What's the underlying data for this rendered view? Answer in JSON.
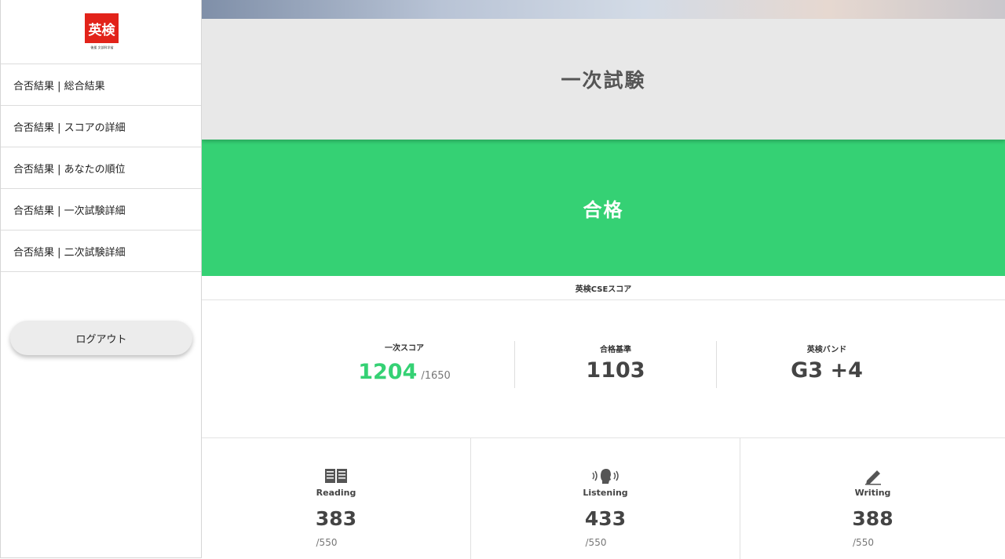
{
  "logo": {
    "text": "英検",
    "subtext": "後援 文部科学省",
    "color": "#e2231a"
  },
  "sidebar": {
    "items": [
      {
        "label": "合否結果 | 総合結果"
      },
      {
        "label": "合否結果 | スコアの詳細"
      },
      {
        "label": "合否結果 | あなたの順位"
      },
      {
        "label": "合否結果 | 一次試験詳細"
      },
      {
        "label": "合否結果 | 二次試験詳細"
      }
    ],
    "logout_label": "ログアウト"
  },
  "main": {
    "exam_title": "一次試験",
    "result": "合格",
    "result_color": "#35d174",
    "cse_label": "英検CSEスコア",
    "stats": {
      "first_score_label": "一次スコア",
      "first_score": "1204",
      "first_score_max": "/1650",
      "pass_line_label": "合格基準",
      "pass_line": "1103",
      "band_label": "英検バンド",
      "band": "G3 +4"
    },
    "skills": [
      {
        "name": "Reading",
        "icon": "book-icon",
        "score": "383",
        "max": "/550"
      },
      {
        "name": "Listening",
        "icon": "listening-head-icon",
        "score": "433",
        "max": "/550"
      },
      {
        "name": "Writing",
        "icon": "pencil-icon",
        "score": "388",
        "max": "/550"
      }
    ]
  }
}
